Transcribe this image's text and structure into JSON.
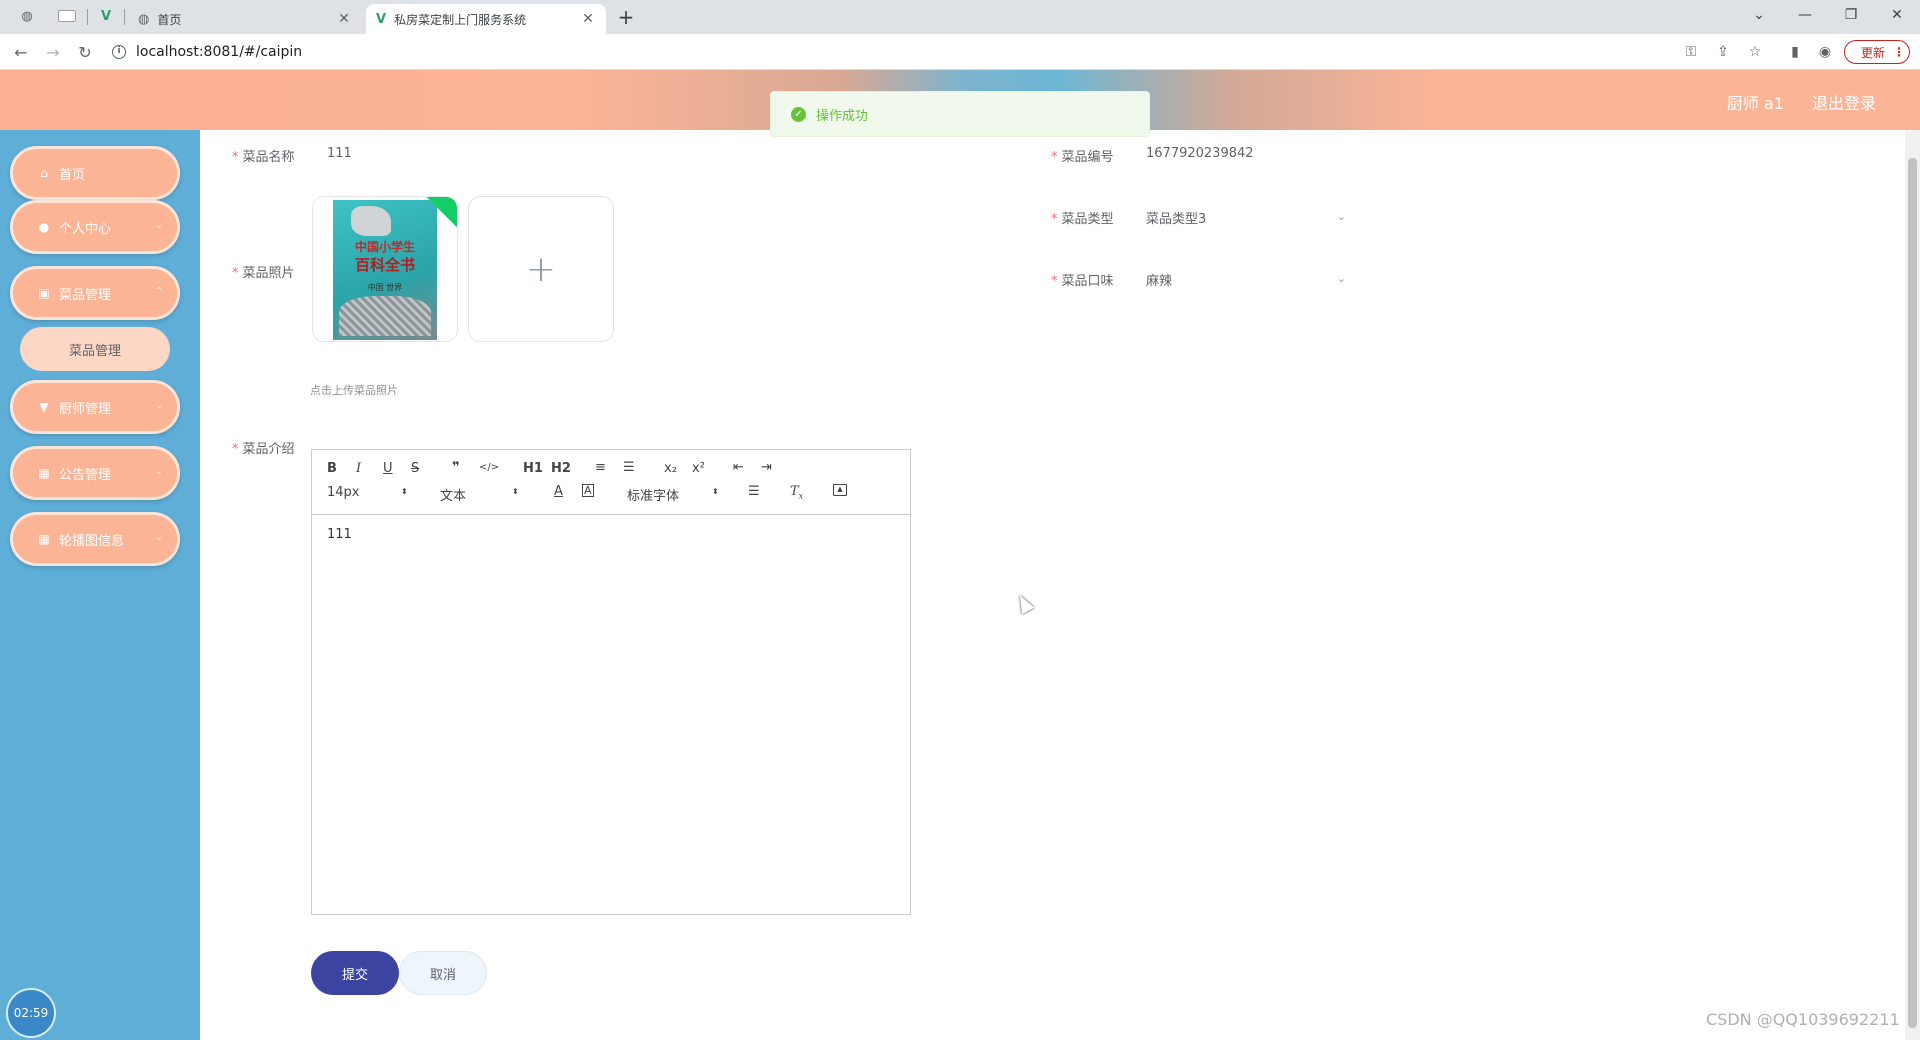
{
  "browser": {
    "tabs": [
      {
        "label": "首页",
        "icon": "globe-icon",
        "active": false
      },
      {
        "label": "私房菜定制上门服务系统",
        "icon": "vue-icon",
        "active": true
      }
    ],
    "url": "localhost:8081/#/caipin",
    "update_label": "更新"
  },
  "header": {
    "user_label": "厨师 a1",
    "logout_label": "退出登录",
    "gradient_colors": [
      "#fcaf92",
      "#6cb7d6"
    ]
  },
  "toast": {
    "message": "操作成功",
    "color": "#67c23a"
  },
  "sidebar": {
    "items": [
      {
        "label": "首页",
        "icon": "home-icon"
      },
      {
        "label": "个人中心",
        "icon": "user-icon"
      },
      {
        "label": "菜品管理",
        "icon": "clipboard-icon"
      },
      {
        "label": "厨师管理",
        "icon": "chef-icon"
      },
      {
        "label": "公告管理",
        "icon": "grid-icon"
      },
      {
        "label": "轮播图信息",
        "icon": "grid-icon"
      }
    ],
    "submenu": {
      "label": "菜品管理"
    },
    "clock": "02:59",
    "bg_color": "#5eaed8",
    "item_color": "#fcb497"
  },
  "form": {
    "name": {
      "label": "菜品名称",
      "value": "111"
    },
    "number": {
      "label": "菜品编号",
      "value": "1677920239842"
    },
    "type": {
      "label": "菜品类型",
      "value": "菜品类型3"
    },
    "taste": {
      "label": "菜品口味",
      "value": "麻辣"
    },
    "photo": {
      "label": "菜品照片",
      "hint": "点击上传菜品照片",
      "cover_text": {
        "line1": "中国小学生",
        "line2": "百科全书",
        "line3": "中国 世界"
      }
    },
    "intro": {
      "label": "菜品介绍",
      "content": "111"
    }
  },
  "editor": {
    "font_size": "14px",
    "block": "文本",
    "font_family": "标准字体",
    "buttons_row1": [
      "B",
      "I",
      "U",
      "S",
      "❞",
      "</>",
      "H1",
      "H2",
      "≡",
      "☰",
      "x₂",
      "x²",
      "⇤",
      "⇥"
    ]
  },
  "actions": {
    "submit": "提交",
    "cancel": "取消",
    "submit_color": "#3b45a1"
  },
  "watermark": "CSDN @QQ1039692211"
}
